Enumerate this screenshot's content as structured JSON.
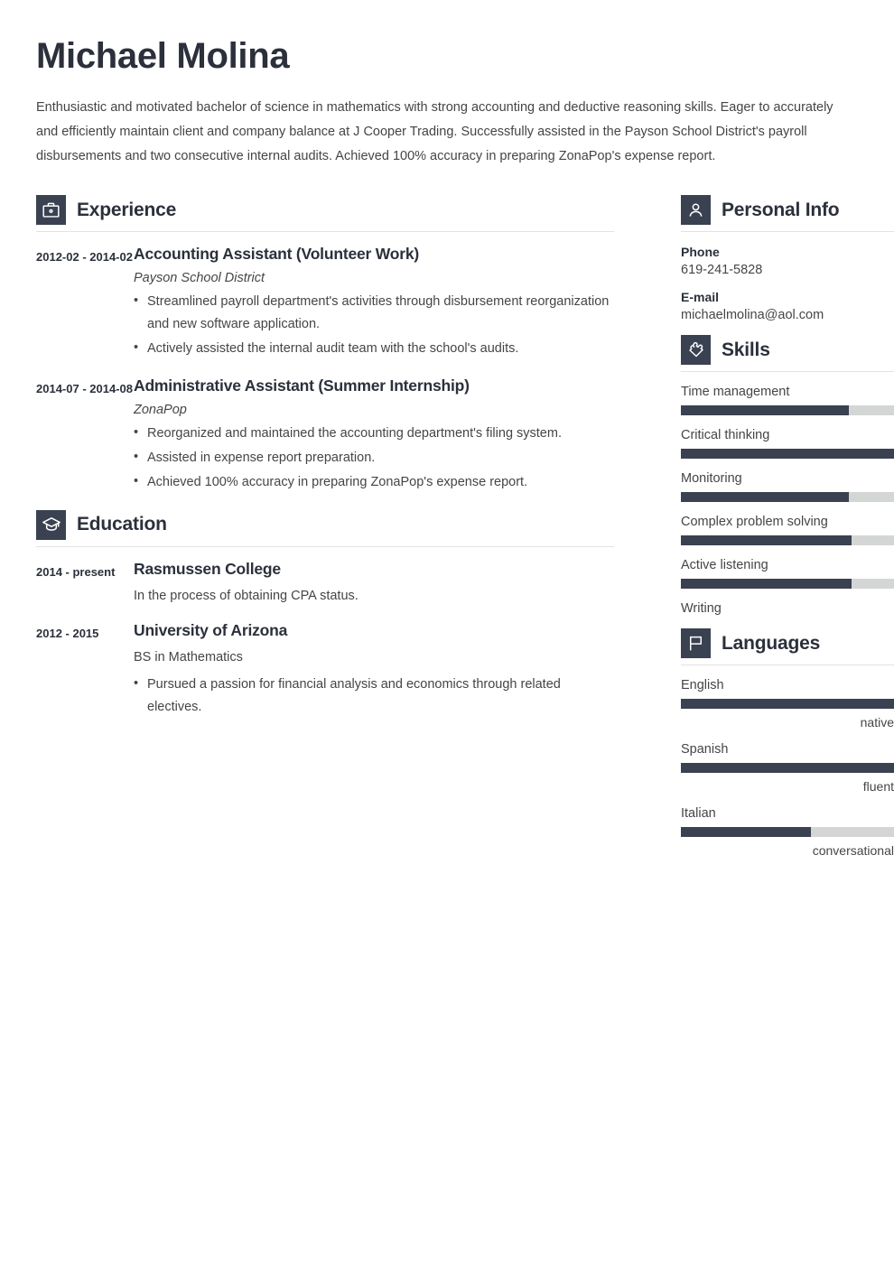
{
  "header": {
    "name": "Michael Molina",
    "summary": "Enthusiastic and motivated bachelor of science in mathematics with strong accounting and deductive reasoning skills. Eager to accurately and efficiently maintain client and company balance at J Cooper Trading. Successfully assisted in the Payson School District's payroll disbursements and two consecutive internal audits. Achieved 100% accuracy in preparing ZonaPop's expense report."
  },
  "colors": {
    "accent": "#3a4150",
    "heading": "#2b303b",
    "body_text": "#454545",
    "bar_track": "#d4d6d6",
    "rule": "#e2e2e2"
  },
  "experience": {
    "title": "Experience",
    "icon": "briefcase-icon",
    "entries": [
      {
        "dates": "2012-02 - 2014-02",
        "title": "Accounting Assistant (Volunteer Work)",
        "organization": "Payson School District",
        "bullets": [
          "Streamlined payroll department's activities through disbursement reorganization and new software application.",
          "Actively assisted the internal audit team with the school's audits."
        ]
      },
      {
        "dates": "2014-07 - 2014-08",
        "title": "Administrative Assistant (Summer Internship)",
        "organization": "ZonaPop",
        "bullets": [
          "Reorganized and maintained the accounting department's filing system.",
          "Assisted in expense report preparation.",
          "Achieved 100% accuracy in preparing ZonaPop's expense report."
        ]
      }
    ]
  },
  "education": {
    "title": "Education",
    "icon": "graduation-cap-icon",
    "entries": [
      {
        "dates": "2014 - present",
        "title": "Rasmussen College",
        "note": "In the process of obtaining CPA status.",
        "bullets": []
      },
      {
        "dates": "2012 - 2015",
        "title": "University of Arizona",
        "note": "BS in Mathematics",
        "bullets": [
          "Pursued a passion for financial analysis and economics through related electives."
        ]
      }
    ]
  },
  "personal_info": {
    "title": "Personal Info",
    "icon": "person-icon",
    "fields": [
      {
        "label": "Phone",
        "value": "619-241-5828"
      },
      {
        "label": "E-mail",
        "value": "michaelmolina@aol.com"
      }
    ]
  },
  "skills": {
    "title": "Skills",
    "icon": "puzzle-piece-icon",
    "items": [
      {
        "name": "Time management",
        "percent": 79,
        "has_bar": true
      },
      {
        "name": "Critical thinking",
        "percent": 100,
        "has_bar": true
      },
      {
        "name": "Monitoring",
        "percent": 79,
        "has_bar": true
      },
      {
        "name": "Complex problem solving",
        "percent": 80,
        "has_bar": true
      },
      {
        "name": "Active listening",
        "percent": 80,
        "has_bar": true
      },
      {
        "name": "Writing",
        "percent": 0,
        "has_bar": false
      }
    ]
  },
  "languages": {
    "title": "Languages",
    "icon": "flag-icon",
    "items": [
      {
        "name": "English",
        "percent": 100,
        "level": "native"
      },
      {
        "name": "Spanish",
        "percent": 100,
        "level": "fluent"
      },
      {
        "name": "Italian",
        "percent": 61,
        "level": "conversational"
      }
    ]
  }
}
